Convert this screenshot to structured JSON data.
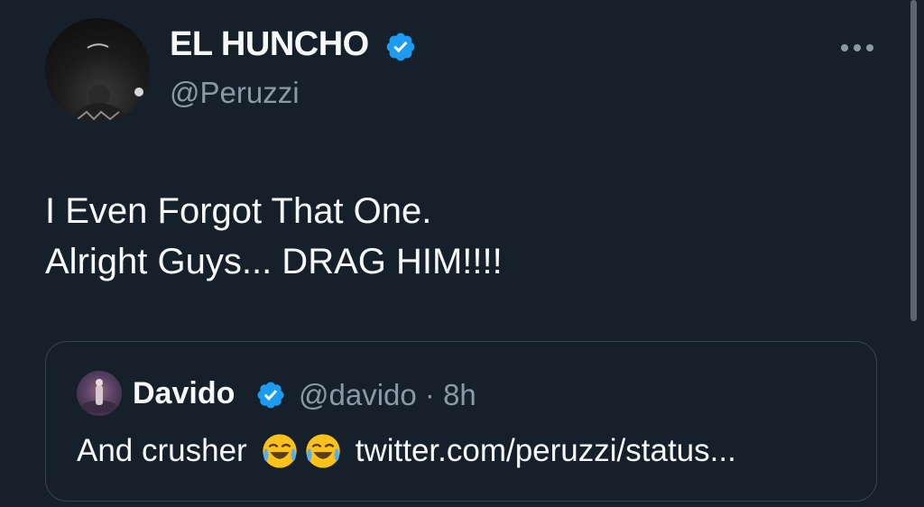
{
  "tweet": {
    "author": {
      "display_name": "EL HUNCHO",
      "handle": "@Peruzzi",
      "verified": true,
      "avatar_icon": "profile-photo"
    },
    "text": "I Even Forgot That One.\nAlright Guys... DRAG HIM!!!!",
    "more_icon": "more-dots-icon",
    "quoted": {
      "display_name": "Davido",
      "handle_time": "@davido · 8h",
      "verified": true,
      "text_prefix": "And crusher",
      "emojis": [
        "tears-of-joy",
        "tears-of-joy"
      ],
      "link": "twitter.com/peruzzi/status..."
    }
  },
  "colors": {
    "background": "#15202b",
    "text": "#f7f9f9",
    "secondary": "#8b98a5",
    "verified": "#1d9bf0",
    "border": "#38444d"
  }
}
